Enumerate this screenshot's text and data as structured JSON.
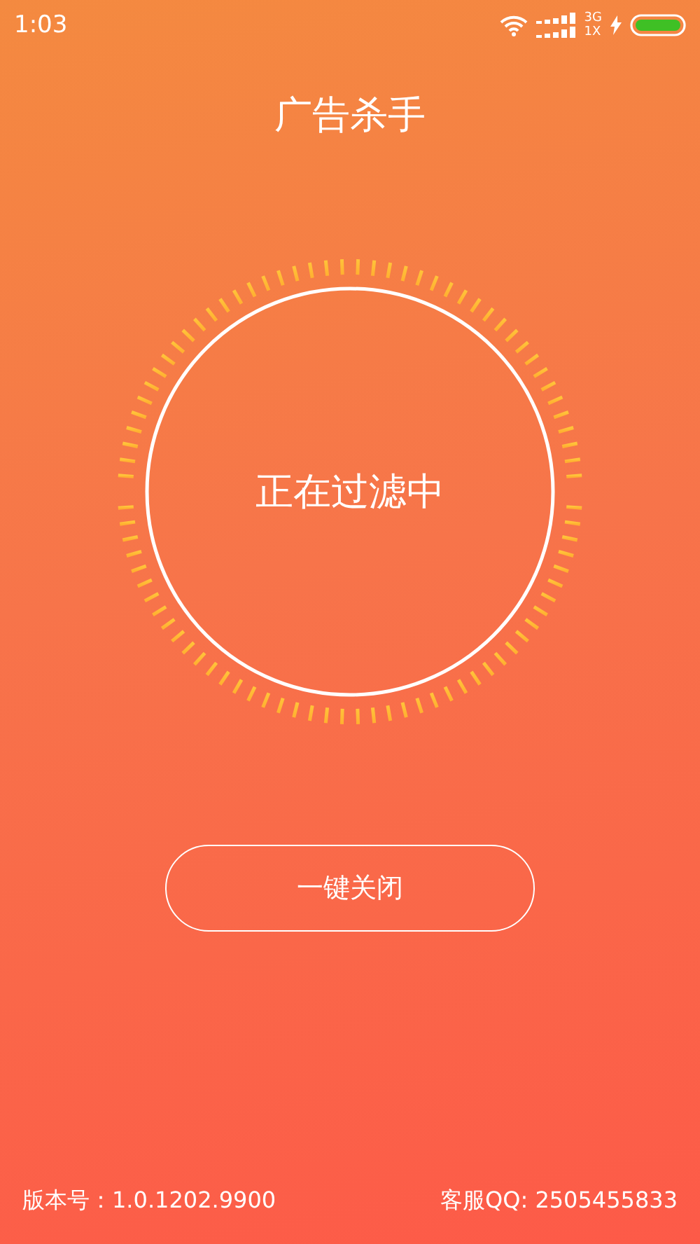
{
  "status_bar": {
    "time": "1:03",
    "network_top": "3G",
    "network_bottom": "1X"
  },
  "title": "广告杀手",
  "status_text": "正在过滤中",
  "close_button": {
    "label": "一键关闭"
  },
  "footer": {
    "version": "版本号：1.0.1202.9900",
    "support": "客服QQ: 2505455833"
  }
}
